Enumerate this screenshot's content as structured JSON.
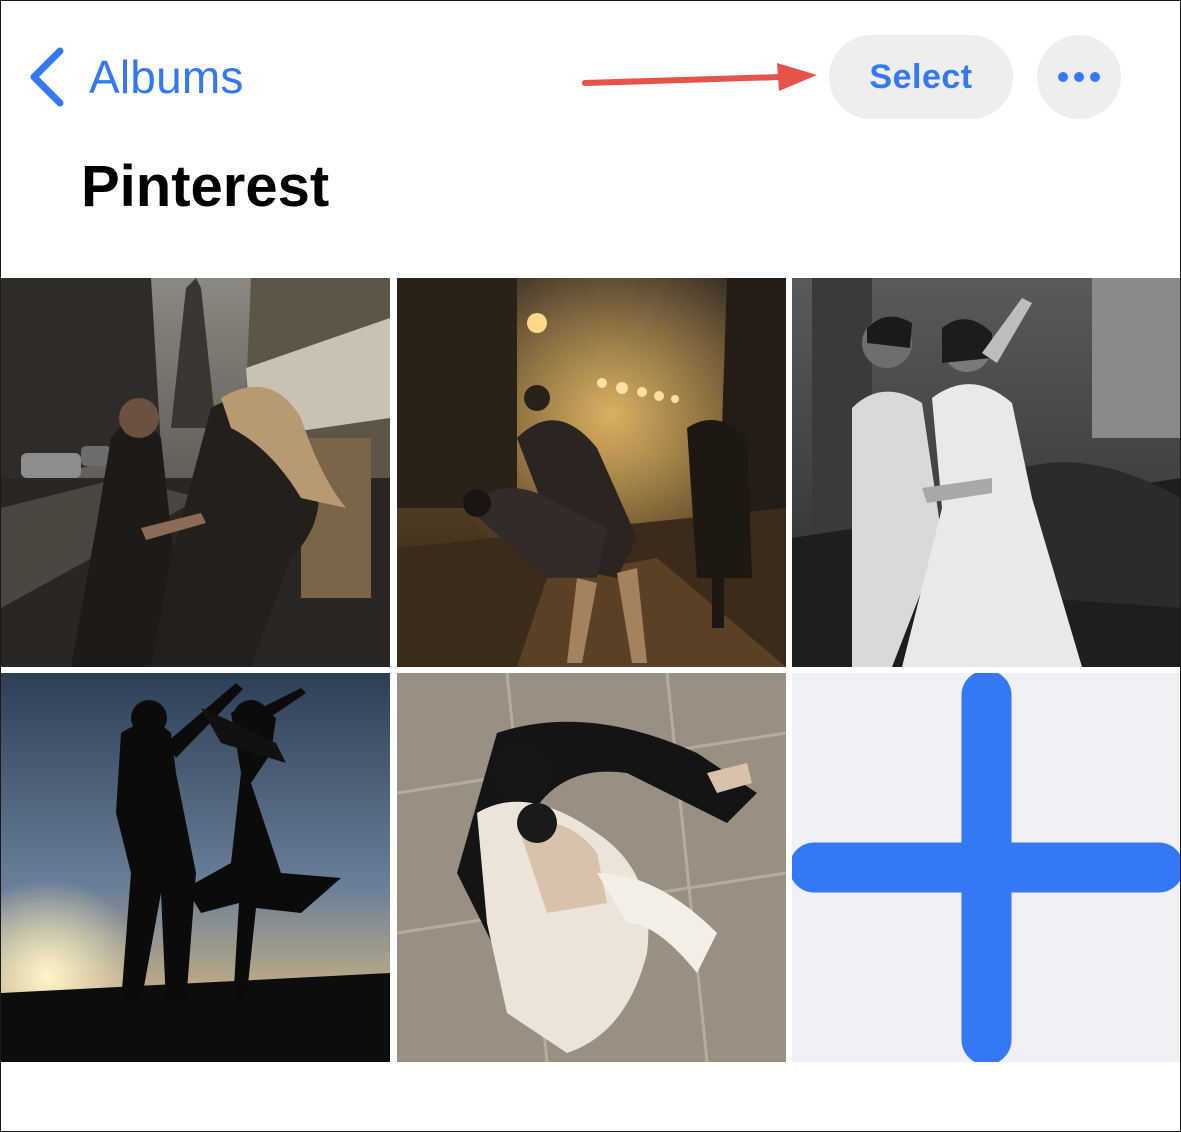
{
  "nav": {
    "back_label": "Albums",
    "select_label": "Select",
    "more_icon": "ellipsis-icon"
  },
  "album": {
    "title": "Pinterest"
  },
  "photos": [
    {
      "name": "photo-couple-paris-street",
      "theme": "dim-brown"
    },
    {
      "name": "photo-couple-rain-street-lights",
      "theme": "warm-night"
    },
    {
      "name": "photo-couple-bw-dress",
      "theme": "grayscale"
    },
    {
      "name": "photo-couple-silhouette-sunset",
      "theme": "dusk-blue"
    },
    {
      "name": "photo-couple-waltz-overhead",
      "theme": "beige-floor"
    }
  ],
  "add_tile": {
    "icon": "plus-icon"
  },
  "colors": {
    "accent": "#3478f6",
    "button_bg": "#eeeef0",
    "annotation_arrow": "#e5534b",
    "add_tile_bg": "#f0f0f5"
  }
}
